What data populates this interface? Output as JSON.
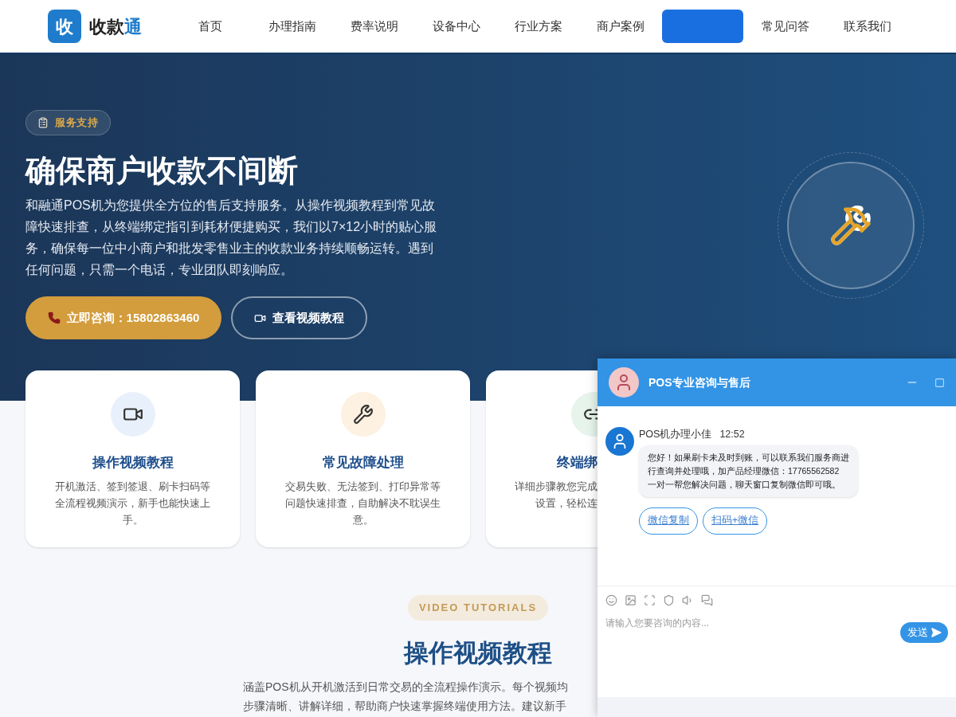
{
  "logo": {
    "mark": "收",
    "name": "收款",
    "name_accent": "通"
  },
  "nav": [
    {
      "label": "首页",
      "selected": false
    },
    {
      "label": "办理指南",
      "selected": false
    },
    {
      "label": "费率说明",
      "selected": false
    },
    {
      "label": "设备中心",
      "selected": false
    },
    {
      "label": "行业方案",
      "selected": false
    },
    {
      "label": "商户案例",
      "selected": false
    },
    {
      "selected": true
    },
    {
      "label": "常见问答",
      "selected": false
    },
    {
      "label": "联系我们",
      "selected": false
    }
  ],
  "hero": {
    "badge": "服务支持",
    "title": "确保商户收款不间断",
    "description": "和融通POS机为您提供全方位的售后支持服务。从操作视频教程到常见故障快速排查，从终端绑定指引到耗材便捷购买，我们以7×12小时的贴心服务，确保每一位中小商户和批发零售业主的收款业务持续顺畅运转。遇到任何问题，只需一个电话，专业团队即刻响应。",
    "buttons": [
      {
        "kind": "primary",
        "label": "立即咨询：15802863460"
      },
      {
        "kind": "outline",
        "label": "查看视频教程"
      }
    ]
  },
  "cards": [
    {
      "kind": "video",
      "title": "操作视频教程",
      "lines": [
        "开机激活、签到签退、刷卡扫码等",
        "全流程视频演示，新手也能快速上",
        "手。"
      ]
    },
    {
      "kind": "repair",
      "title": "常见故障处理",
      "lines": [
        "交易失败、无法签到、打印异常等",
        "问题快速排查，自助解决不耽误生",
        "意。"
      ]
    },
    {
      "kind": "bind",
      "title": "终端绑",
      "lines": [
        "详细步骤教您完成",
        "设置，轻松连"
      ]
    }
  ],
  "section": {
    "tag": "VIDEO TUTORIALS",
    "title": "操作视频教程",
    "lines": [
      "涵盖POS机从开机激活到日常交易的全流程操作演示。每个视频均",
      "步骤清晰、讲解详细，帮助商户快速掌握终端使用方法。建议新手"
    ]
  },
  "chat": {
    "title": "POS专业咨询与售后",
    "messages": [
      {
        "sender": "POS机办理小佳",
        "time": "12:52",
        "text": "您好！如果刷卡未及时到账，可以联系我们服务商进行查询并处理哦，加产品经理微信：17765562582 一对一帮您解决问题，聊天窗口复制微信即可哦。"
      }
    ],
    "quick_replies": [
      "微信复制",
      "扫码+微信"
    ],
    "input": {
      "placeholder": "请输入您要咨询的内容..."
    },
    "send": "发送"
  }
}
